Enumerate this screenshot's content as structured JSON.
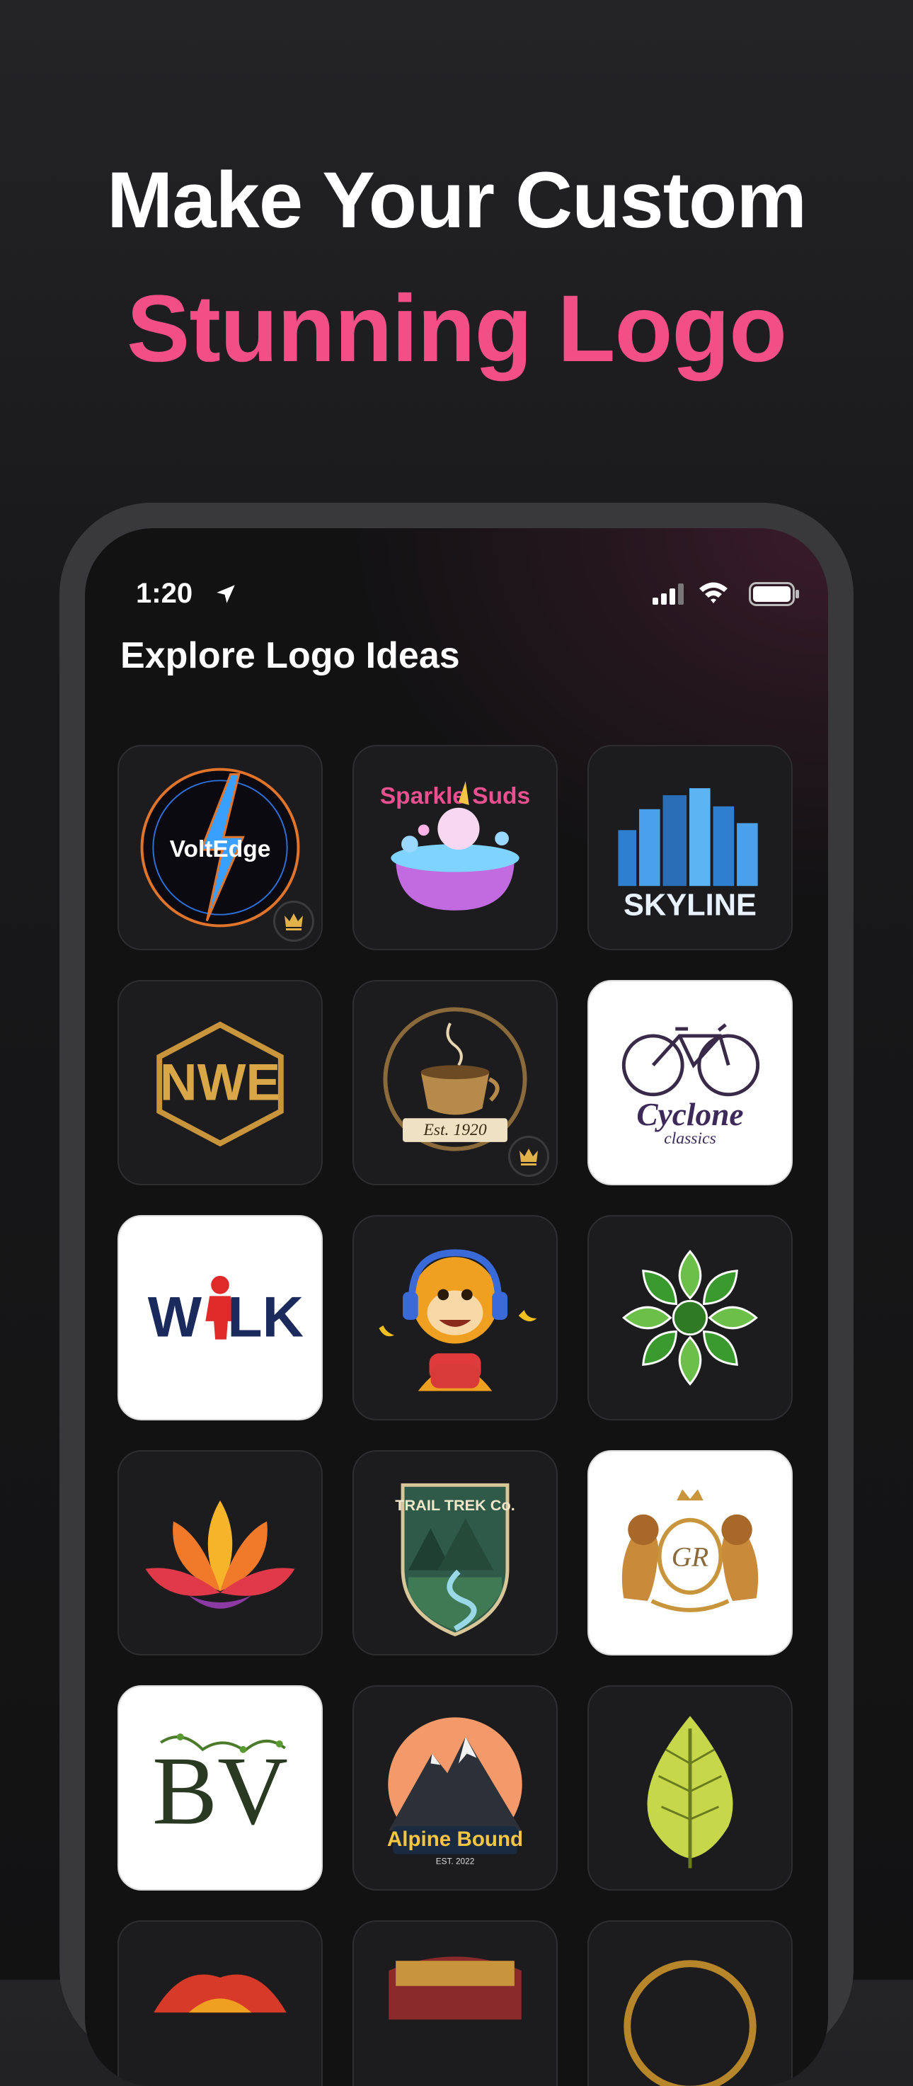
{
  "promo": {
    "line1": "Make Your Custom",
    "line2": "Stunning Logo"
  },
  "colors": {
    "accent_pink": "#f24f86",
    "tile_dark": "#1c1c1e",
    "premium_gold": "#e3b14a"
  },
  "status_bar": {
    "time": "1:20",
    "icons": [
      "location-arrow-icon",
      "cellular-signal-icon",
      "wifi-icon",
      "battery-icon"
    ]
  },
  "screen": {
    "title": "Explore Logo Ideas"
  },
  "logos": [
    {
      "name": "VoltEdge",
      "text": "VoltEdge",
      "premium": true
    },
    {
      "name": "Sparkle Suds",
      "text": "Sparkle Suds",
      "premium": false
    },
    {
      "name": "Skyline",
      "text": "SKYLINE",
      "premium": false
    },
    {
      "name": "NWE",
      "text": "NWE",
      "premium": false
    },
    {
      "name": "Est. 1920 coffee",
      "text": "Est. 1920",
      "premium": true
    },
    {
      "name": "Cyclone Classics",
      "text": "Cyclone",
      "text2": "classics",
      "premium": false
    },
    {
      "name": "Walk",
      "text_a": "W",
      "text_b": "LK",
      "premium": false
    },
    {
      "name": "Monkey gamer",
      "premium": false
    },
    {
      "name": "Green flower",
      "premium": false
    },
    {
      "name": "Lotus",
      "premium": false
    },
    {
      "name": "Trail Trek Co.",
      "text": "TRAIL TREK Co.",
      "premium": false
    },
    {
      "name": "GR lions crest",
      "text": "GR",
      "premium": false
    },
    {
      "name": "BV",
      "text": "BV",
      "premium": false
    },
    {
      "name": "Alpine Bound",
      "text": "Alpine Bound",
      "text2": "EST. 2022",
      "premium": false
    },
    {
      "name": "Leaf",
      "premium": false
    }
  ]
}
